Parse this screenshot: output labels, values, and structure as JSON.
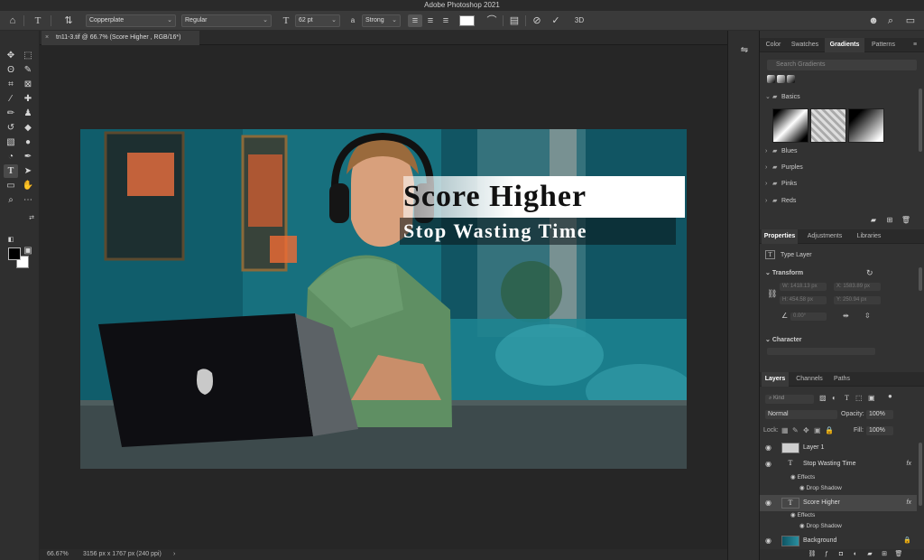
{
  "app": {
    "title": "Adobe Photoshop 2021"
  },
  "options_bar": {
    "font_family": "Copperplate",
    "font_style": "Regular",
    "font_size": "62 pt",
    "antialias": "Strong",
    "text_color": "#ffffff",
    "button_3d": "3D",
    "aa_label": "a"
  },
  "document": {
    "tab_title": "tn11-3.tif @ 66.7% (Score Higher , RGB/16*)",
    "headline": "Score Higher",
    "subline": "Stop Wasting Time",
    "zoom": "66.67%",
    "info": "3156 px x 1767 px (240 ppi)"
  },
  "gradients_panel": {
    "tabs": [
      "Color",
      "Swatches",
      "Gradients",
      "Patterns"
    ],
    "active_tab": "Gradients",
    "search_placeholder": "Search Gradients",
    "groups": [
      "Basics",
      "Blues",
      "Purples",
      "Pinks",
      "Reds"
    ]
  },
  "properties_panel": {
    "tabs": [
      "Properties",
      "Adjustments",
      "Libraries"
    ],
    "active_tab": "Properties",
    "layer_type": "Type Layer",
    "transform_label": "Transform",
    "fields": {
      "w": "W: 1418.13 px",
      "x": "X: 1583.89 px",
      "h": "H: 454.58 px",
      "y": "Y: 250.94 px",
      "angle": "0.00°"
    },
    "character_label": "Character"
  },
  "layers_panel": {
    "tabs": [
      "Layers",
      "Channels",
      "Paths"
    ],
    "active_tab": "Layers",
    "filter_label": "Kind",
    "blend_mode": "Normal",
    "opacity_label": "Opacity:",
    "opacity": "100%",
    "lock_label": "Lock:",
    "fill_label": "Fill:",
    "fill": "100%",
    "layers": [
      {
        "name": "Layer 1",
        "type": "image",
        "fx": ""
      },
      {
        "name": "Stop Wasting Time",
        "type": "text",
        "fx": "fx",
        "effects_label": "Effects",
        "effect": "Drop Shadow"
      },
      {
        "name": "Score Higher",
        "type": "text",
        "fx": "fx",
        "effects_label": "Effects",
        "effect": "Drop Shadow",
        "selected": true
      },
      {
        "name": "Background",
        "type": "image",
        "fx": ""
      }
    ]
  }
}
